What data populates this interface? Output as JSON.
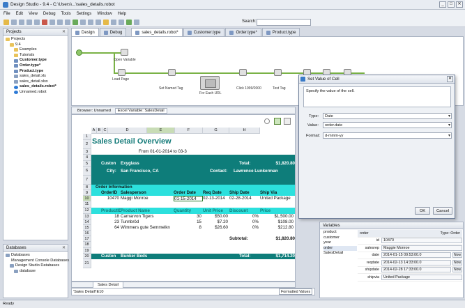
{
  "window": {
    "title": "Design Studio - 9.4 - C:\\Users\\...\\sales_details.robot",
    "controls": [
      "_",
      "□",
      "✕"
    ]
  },
  "menu": [
    "File",
    "Edit",
    "View",
    "Debug",
    "Tools",
    "Settings",
    "Window",
    "Help"
  ],
  "search": {
    "label": "Search:",
    "value": ""
  },
  "projects": {
    "title": "Projects",
    "items": [
      {
        "label": "Projects",
        "indent": 0,
        "icon": "folder",
        "bold": false
      },
      {
        "label": "9.4",
        "indent": 1,
        "icon": "folder",
        "bold": false
      },
      {
        "label": "Examples",
        "indent": 2,
        "icon": "folder",
        "bold": false
      },
      {
        "label": "Tutorials",
        "indent": 2,
        "icon": "folder",
        "bold": false
      },
      {
        "label": "Customer.type",
        "indent": 2,
        "icon": "type",
        "bold": true
      },
      {
        "label": "Order.type*",
        "indent": 2,
        "icon": "type",
        "bold": true
      },
      {
        "label": "Product.type",
        "indent": 2,
        "icon": "type",
        "bold": true
      },
      {
        "label": "sales_detail.xls",
        "indent": 2,
        "icon": "file",
        "bold": false
      },
      {
        "label": "sales_detail.xlsx",
        "indent": 2,
        "icon": "file",
        "bold": false
      },
      {
        "label": "sales_details.robot*",
        "indent": 2,
        "icon": "robot",
        "bold": true
      },
      {
        "label": "Unnamed.robot",
        "indent": 2,
        "icon": "robot",
        "bold": false
      }
    ]
  },
  "databases": {
    "title": "Databases",
    "items": [
      {
        "label": "Databases",
        "indent": 0
      },
      {
        "label": "Management Console Databases",
        "indent": 1
      },
      {
        "label": "Design Studio Databases",
        "indent": 1
      },
      {
        "label": "database",
        "indent": 2
      }
    ]
  },
  "mode_tabs": [
    "Design",
    "Debug"
  ],
  "editor_tabs": [
    "sales_details.robot*",
    "Customer.type",
    "Order.type*",
    "Product.type"
  ],
  "flow": {
    "labels": [
      "Open Variable",
      "Load Page",
      "Set Named Tag",
      "For Each URL",
      "Click 1999/2000",
      "Test Tag"
    ]
  },
  "browser_tabs": {
    "browser": "Browser: Unnamed",
    "excel": "Excel Variable: SalesDetail"
  },
  "sheet": {
    "columns": [
      "A",
      "B",
      "C",
      "D",
      "E",
      "F",
      "G",
      "H"
    ],
    "rows": [
      "1",
      "2",
      "3",
      "4",
      "5",
      "6",
      "7",
      "8",
      "9",
      "10",
      "11",
      "12",
      "13",
      "14",
      "15",
      "16",
      "17",
      "18",
      "19",
      "20",
      "21"
    ],
    "title": "Sales Detail Overview",
    "period": "From 01-01-2014 to 03-3",
    "customer_label": "Custon",
    "customer_name": "Exyglass",
    "total_label": "Total:",
    "total_value": "$1,820.80",
    "city_label": "City:",
    "city": "San Francisco, CA",
    "contact_label": "Contact:",
    "contact": "Lawrence Lunkerman",
    "order_info": "Order Information",
    "order_headers": [
      "OrderID",
      "Salesperson",
      "Order Date",
      "Req Date",
      "Ship Date",
      "Ship Via"
    ],
    "order_row": [
      "10470",
      "Maggi Monroe",
      "01-15-2014",
      "02-13-2014",
      "02-28-2014",
      "United Package"
    ],
    "product_headers": [
      "ProductID",
      "Product Name",
      "Quantity",
      "Unit Price",
      "Discount",
      "Price"
    ],
    "products": [
      [
        "18",
        "Carnarvon Tigers",
        "30",
        "$50.00",
        "0%",
        "$1,500.00"
      ],
      [
        "23",
        "Tunnbröd",
        "15",
        "$7.20",
        "0%",
        "$108.00"
      ],
      [
        "64",
        "Wimmers gute Semmelkn",
        "8",
        "$26.60",
        "0%",
        "$212.80"
      ]
    ],
    "subtotal_label": "Subtotal:",
    "subtotal": "$1,820.80",
    "customer2_label": "Custon",
    "customer2_name": "Bunker Beds",
    "total2_value": "$1,714.20"
  },
  "sheet_tab": "Sales Detail",
  "formula": "'Sales Detail'!E10",
  "format_select": "Formatted Values",
  "status": "Ready",
  "dialog": {
    "title": "Set Value of Cell",
    "description": "Specify the value of the cell.",
    "type_label": "Type:",
    "type_value": "Date",
    "value_label": "Value:",
    "value_value": "order.date",
    "format_label": "Format:",
    "format_value": "d-mmm-yy",
    "ok": "OK",
    "cancel": "Cancel"
  },
  "variables": {
    "title": "Variables",
    "list": [
      "product",
      "customer",
      "year",
      "order",
      "SalesDetail"
    ],
    "selected": "order",
    "header_name": "order",
    "header_type": "Type: Order",
    "fields": [
      {
        "key": "id",
        "value": "10470",
        "now": false
      },
      {
        "key": "salesrep",
        "value": "Maggie Monroe",
        "now": false
      },
      {
        "key": "date",
        "value": "2014-01-15 09:53:00.0",
        "now": true
      },
      {
        "key": "reqdate",
        "value": "2014-02-13 14:33:00.0",
        "now": true
      },
      {
        "key": "shipdate",
        "value": "2014-02-28 17:33:00.0",
        "now": true
      },
      {
        "key": "shipvia",
        "value": "United Package",
        "now": false
      }
    ],
    "now_label": "Now"
  }
}
